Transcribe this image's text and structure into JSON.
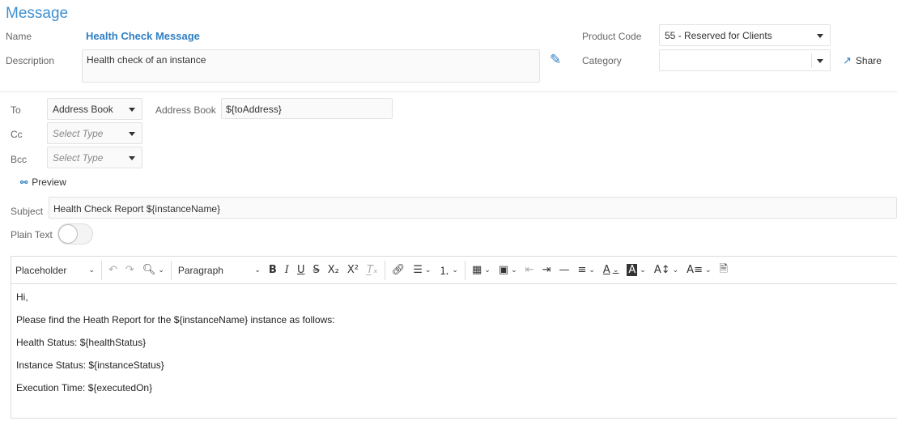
{
  "page": {
    "title": "Message"
  },
  "form": {
    "name_label": "Name",
    "name_value": "Health Check Message",
    "description_label": "Description",
    "description_value": "Health check of an instance",
    "product_code_label": "Product Code",
    "product_code_value": "55 - Reserved for Clients",
    "category_label": "Category",
    "category_value": "",
    "share_label": "Share"
  },
  "recipients": {
    "to_label": "To",
    "to_value": "Address Book",
    "address_book_label": "Address Book",
    "address_book_value": "${toAddress}",
    "cc_label": "Cc",
    "cc_placeholder": "Select Type",
    "bcc_label": "Bcc",
    "bcc_placeholder": "Select Type",
    "preview_label": "Preview",
    "subject_label": "Subject",
    "subject_value": "Health Check Report ${instanceName}",
    "plain_text_label": "Plain Text",
    "plain_text_on": false
  },
  "editor": {
    "placeholder_menu": "Placeholder",
    "block_format": "Paragraph",
    "body": [
      "Hi,",
      "Please find the Heath Report for the ${instanceName} instance as follows:",
      "Health Status: ${healthStatus}",
      "Instance Status: ${instanceStatus}",
      "Execution Time: ${executedOn}"
    ]
  },
  "colors": {
    "accent": "#3d8fd1"
  }
}
